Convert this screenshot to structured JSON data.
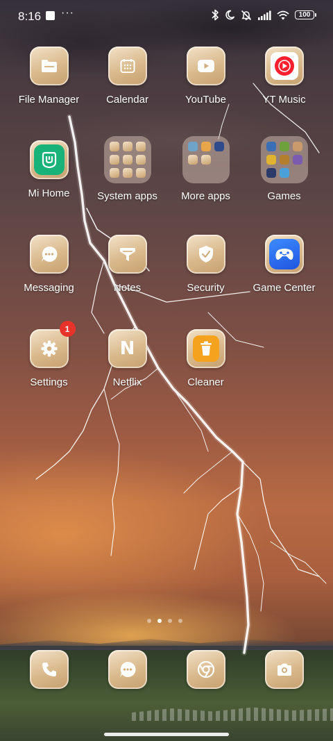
{
  "status_bar": {
    "time": "8:16",
    "battery": "100"
  },
  "apps": [
    {
      "label": "File Manager",
      "icon": "folder-icon"
    },
    {
      "label": "Calendar",
      "icon": "calendar-icon"
    },
    {
      "label": "YouTube",
      "icon": "play-icon"
    },
    {
      "label": "YT Music",
      "icon": "yt-music-icon"
    },
    {
      "label": "Mi Home",
      "icon": "mi-home-icon"
    },
    {
      "label": "System apps",
      "icon": "folder-grid"
    },
    {
      "label": "More apps",
      "icon": "folder-grid"
    },
    {
      "label": "Games",
      "icon": "folder-grid"
    },
    {
      "label": "Messaging",
      "icon": "chat-bubble-icon"
    },
    {
      "label": "Notes",
      "icon": "notes-icon"
    },
    {
      "label": "Security",
      "icon": "shield-check-icon"
    },
    {
      "label": "Game Center",
      "icon": "gamepad-icon"
    },
    {
      "label": "Settings",
      "icon": "gear-icon",
      "badge": "1"
    },
    {
      "label": "Netflix",
      "icon": "netflix-n-icon",
      "glyph": "N"
    },
    {
      "label": "Cleaner",
      "icon": "trash-icon"
    }
  ],
  "dock": [
    {
      "icon": "phone-icon"
    },
    {
      "icon": "chat-bubble-icon"
    },
    {
      "icon": "chrome-icon"
    },
    {
      "icon": "camera-icon"
    }
  ],
  "pager": {
    "pages": 4,
    "active": 1
  },
  "colors": {
    "icon_tint": "#d9b98c",
    "badge": "#e8332a",
    "yt_music_red": "#ff1f2e",
    "mi_home_green": "#19b37a",
    "game_center_blue": "#2a6df5",
    "cleaner_orange": "#f5a21e"
  }
}
